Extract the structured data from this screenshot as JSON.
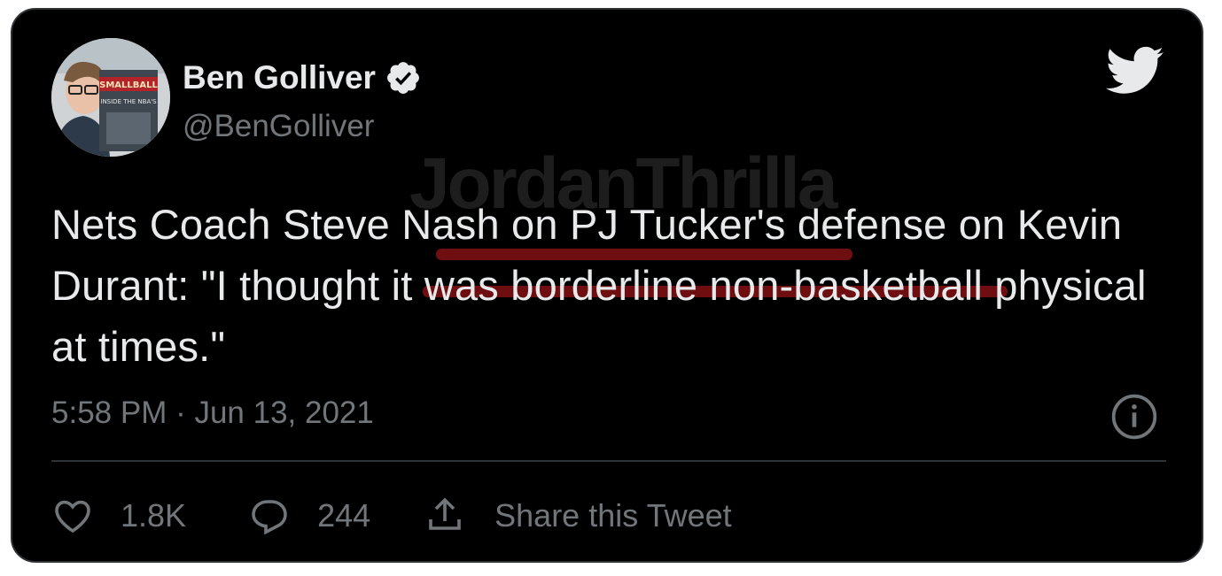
{
  "author": {
    "display_name": "Ben Golliver",
    "handle": "@BenGolliver",
    "verified": true,
    "avatar_book_text": "SMALLBALL INSIDE THE NBA'S"
  },
  "tweet": {
    "text": "Nets Coach Steve Nash on PJ Tucker's defense on Kevin Durant: \"I thought it was borderline non-basketball physical at times.\"",
    "timestamp": "5:58 PM · Jun 13, 2021"
  },
  "watermark": {
    "text": "JordanThrilla"
  },
  "actions": {
    "like_count": "1.8K",
    "reply_count": "244",
    "share_label": "Share this Tweet"
  },
  "icons": {
    "brand": "twitter-bird-icon",
    "verified": "verified-badge-icon",
    "info": "info-icon",
    "like": "heart-icon",
    "reply": "reply-bubble-icon",
    "share": "share-icon"
  },
  "colors": {
    "background": "#000000",
    "text_primary": "#e7e9ea",
    "text_secondary": "#71767b",
    "divider": "#2f3336",
    "highlight_underline": "#7a0f12"
  }
}
